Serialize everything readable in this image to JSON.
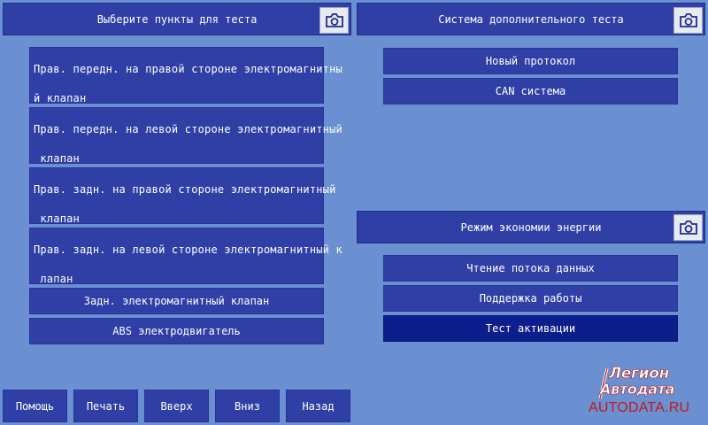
{
  "left_panel": {
    "title": "Выберите пункты для теста",
    "items": [
      {
        "text": "Прав. передн. на правой стороне электромагнитны\nй клапан"
      },
      {
        "text": "Прав. передн. на левой стороне электромагнитный\n клапан"
      },
      {
        "text": "Прав. задн. на правой стороне электромагнитный\n клапан"
      },
      {
        "text": "Прав. задн. на левой стороне электромагнитный к\n лапан"
      },
      {
        "text": "Задн. электромагнитный клапан"
      },
      {
        "text": "ABS электродвигатель"
      }
    ]
  },
  "right_top": {
    "title": "Система дополнительного теста",
    "items": [
      {
        "text": "Новый протокол"
      },
      {
        "text": "CAN система"
      }
    ]
  },
  "right_bottom": {
    "title": "Режим экономии энергии",
    "items": [
      {
        "text": "Чтение потока данных"
      },
      {
        "text": "Поддержка работы"
      },
      {
        "text": "Тест активации",
        "selected": true
      }
    ]
  },
  "bottom_bar": {
    "buttons": [
      "Помощь",
      "Печать",
      "Вверх",
      "Вниз",
      "Назад"
    ]
  },
  "logo": {
    "line1": "Легион",
    "line2": "Автодата",
    "url": "AUTODATA.RU"
  },
  "colors": {
    "background": "#6a90d2",
    "button": "#2f3fa6",
    "button_selected": "#0c1e8c",
    "logo_red": "#c41818"
  },
  "icons": {
    "screenshot": "camera-icon"
  }
}
